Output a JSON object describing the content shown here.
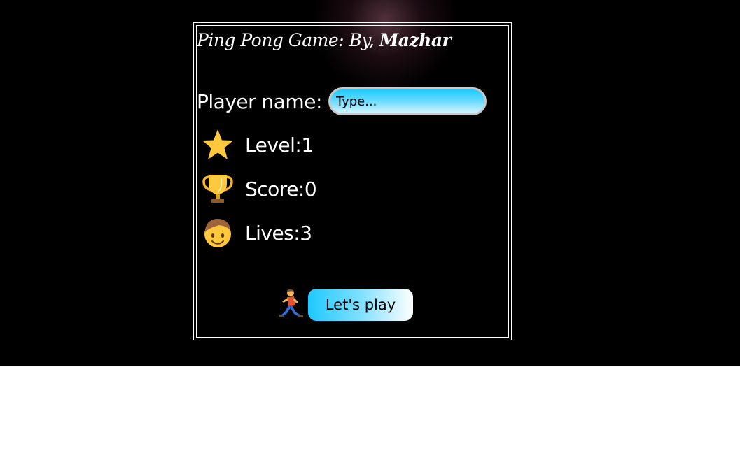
{
  "header": {
    "title_prefix": "Ping Pong Game: By,",
    "title_author": "Mazhar"
  },
  "player": {
    "label": "Player name:",
    "placeholder": "Type...",
    "value": ""
  },
  "stats": {
    "level": {
      "text": "Level:1",
      "value": 1,
      "icon": "star-icon",
      "color": "#ffc83d"
    },
    "score": {
      "text": "Score:0",
      "value": 0,
      "icon": "trophy-icon",
      "color": "#f7b733"
    },
    "lives": {
      "text": "Lives:3",
      "value": 3,
      "icon": "face-icon",
      "color": "#ffc83d"
    }
  },
  "play": {
    "icon": "running-person-icon",
    "label": "Let's play"
  },
  "colors": {
    "background": "#000000",
    "text": "#ffffff",
    "accent_cyan": "#1ec8ff",
    "gold": "#ffc83d"
  }
}
